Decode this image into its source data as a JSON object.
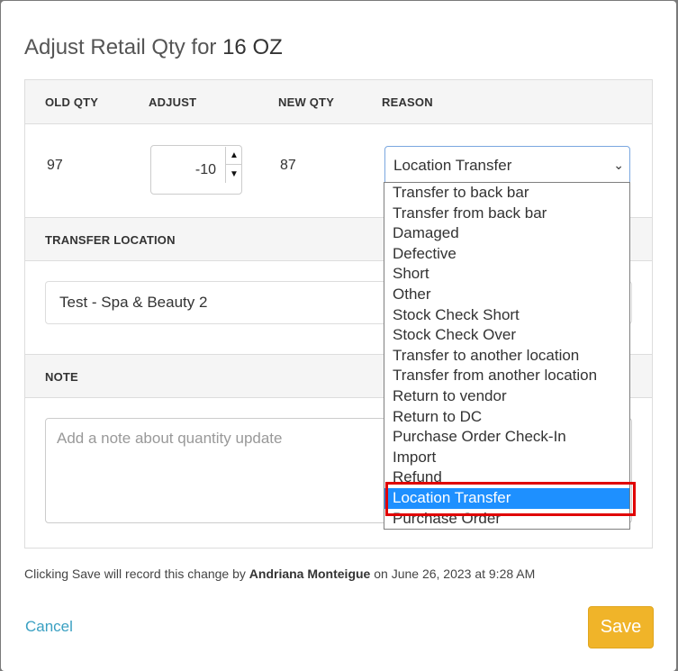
{
  "dialog": {
    "title_prefix": "Adjust Retail Qty for ",
    "title_item": "16 OZ"
  },
  "columns": {
    "old_qty": "OLD QTY",
    "adjust": "ADJUST",
    "new_qty": "NEW QTY",
    "reason": "REASON"
  },
  "row": {
    "old_qty": "97",
    "adjust_value": "-10",
    "new_qty": "87",
    "reason_selected": "Location Transfer"
  },
  "transfer": {
    "header": "TRANSFER LOCATION",
    "value": "Test - Spa & Beauty 2"
  },
  "note": {
    "header": "NOTE",
    "placeholder": "Add a note about quantity update"
  },
  "reason_options": [
    "Transfer to back bar",
    "Transfer from back bar",
    "Damaged",
    "Defective",
    "Short",
    "Other",
    "Stock Check Short",
    "Stock Check Over",
    "Transfer to another location",
    "Transfer from another location",
    "Return to vendor",
    "Return to DC",
    "Purchase Order Check-In",
    "Import",
    "Refund",
    "Location Transfer",
    "Purchase Order"
  ],
  "footer": {
    "prefix": "Clicking Save will record this change by ",
    "user": "Andriana Monteigue",
    "suffix": " on June 26, 2023 at 9:28 AM"
  },
  "actions": {
    "cancel_label": "Cancel",
    "save_label": "Save"
  },
  "colors": {
    "save_button": "#f0b429",
    "cancel_link": "#3aa0c2",
    "selected_option": "#1e90ff",
    "highlight_box": "#e00000"
  },
  "icons": {
    "spinner_up": "triangle-up-icon",
    "spinner_down": "triangle-down-icon",
    "select_arrow": "chevron-down-icon"
  }
}
